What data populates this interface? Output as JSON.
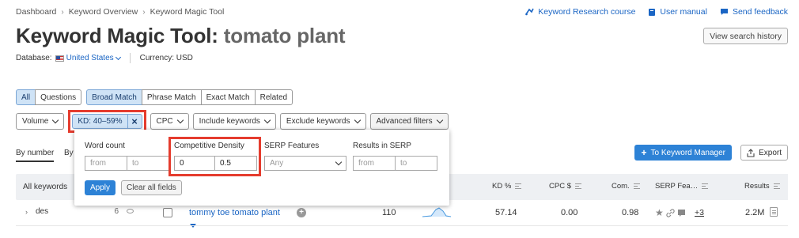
{
  "breadcrumb": [
    "Dashboard",
    "Keyword Overview",
    "Keyword Magic Tool"
  ],
  "top_links": {
    "course": "Keyword Research course",
    "manual": "User manual",
    "feedback": "Send feedback"
  },
  "title": {
    "tool": "Keyword Magic Tool:",
    "query": "tomato plant"
  },
  "view_history": "View search history",
  "database": {
    "label": "Database:",
    "value": "United States",
    "currency": "Currency: USD"
  },
  "tabs_type": [
    "All",
    "Questions"
  ],
  "tabs_match": [
    "Broad Match",
    "Phrase Match",
    "Exact Match",
    "Related"
  ],
  "filters": {
    "volume": "Volume",
    "kd": "KD: 40–59%",
    "cpc": "CPC",
    "include": "Include keywords",
    "exclude": "Exclude keywords",
    "advanced": "Advanced filters"
  },
  "grouping": {
    "by_number": "By number",
    "by_other": "By"
  },
  "panel": {
    "word_count": "Word count",
    "competitive_density": "Competitive Density",
    "serp_features": "SERP Features",
    "results_in_serp": "Results in SERP",
    "from_placeholder": "from",
    "to_placeholder": "to",
    "cd_from": "0",
    "cd_to": "0.5",
    "serp_any": "Any",
    "apply": "Apply",
    "clear": "Clear all fields"
  },
  "actions": {
    "to_manager": "To Keyword Manager",
    "export": "Export"
  },
  "sidebar": {
    "header": "All keywords",
    "items": [
      {
        "label": "des",
        "count": "6"
      }
    ]
  },
  "table": {
    "headers": {
      "kd": "KD %",
      "cpc": "CPC $",
      "com": "Com.",
      "serp": "SERP Fea…",
      "results": "Results"
    },
    "rows": [
      {
        "keyword": "tommy toe tomato plant",
        "volume": "110",
        "kd": "57.14",
        "cpc": "0.00",
        "com": "0.98",
        "serp_more": "+3",
        "results": "2.2M"
      }
    ]
  },
  "colors": {
    "accent": "#2d82d6",
    "highlight": "#e53c2e",
    "link": "#1a65c4"
  }
}
